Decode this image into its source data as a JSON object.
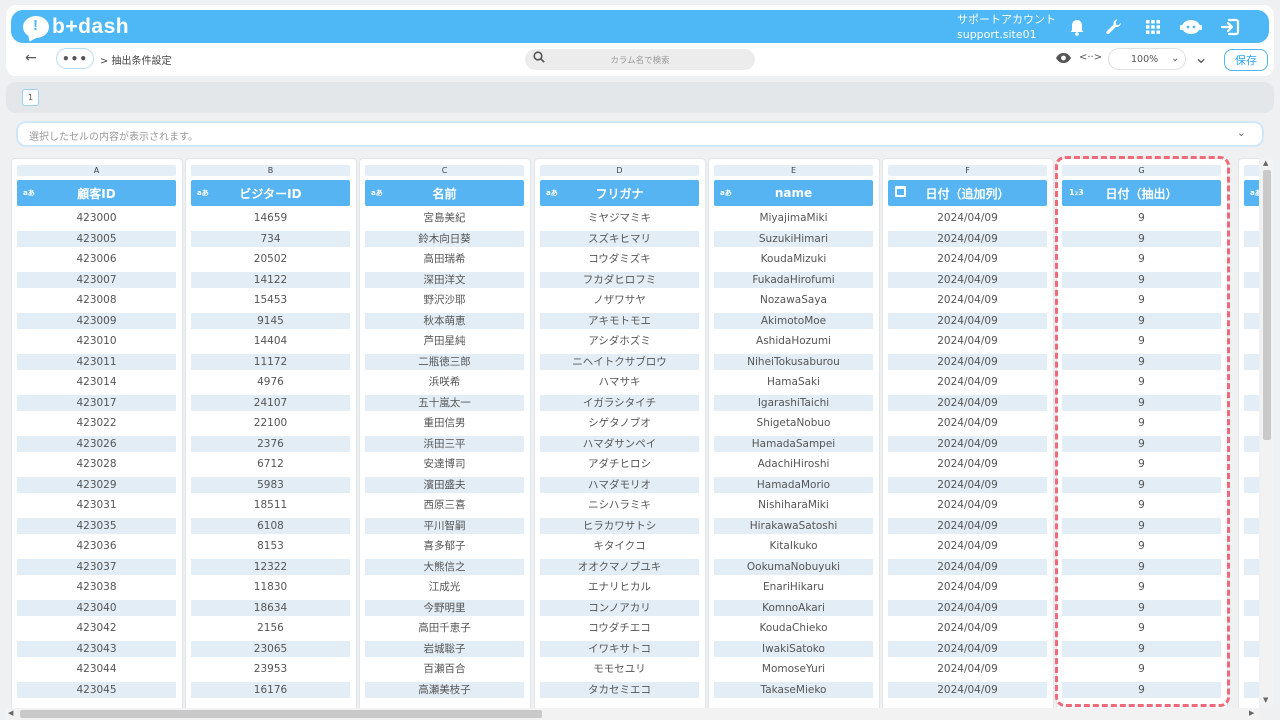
{
  "app": {
    "logo_text": "b+dash",
    "logo_mark": "!"
  },
  "header": {
    "account_label": "サポートアカウント",
    "site_label": "support.site01",
    "icons": [
      "bell-icon",
      "wrench-icon",
      "grid-icon",
      "chat-bot-icon",
      "logout-icon"
    ]
  },
  "toolbar": {
    "back_icon": "←",
    "more_label": "•••",
    "breadcrumb": "> 抽出条件設定",
    "search_placeholder": "カラム名で検索",
    "zoom": "100%",
    "save_label": "保存"
  },
  "pages": {
    "current": "1"
  },
  "cell_preview": {
    "placeholder": "選択したセルの内容が表示されます。"
  },
  "columns": [
    {
      "letter": "A",
      "title": "顧客ID",
      "type_tag": "aあ",
      "type": "text"
    },
    {
      "letter": "B",
      "title": "ビジターID",
      "type_tag": "aあ",
      "type": "text"
    },
    {
      "letter": "C",
      "title": "名前",
      "type_tag": "aあ",
      "type": "text"
    },
    {
      "letter": "D",
      "title": "フリガナ",
      "type_tag": "aあ",
      "type": "text"
    },
    {
      "letter": "E",
      "title": "name",
      "type_tag": "aあ",
      "type": "text"
    },
    {
      "letter": "F",
      "title": "日付（追加列）",
      "type_tag": "",
      "type": "date"
    },
    {
      "letter": "G",
      "title": "日付（抽出）",
      "type_tag": "1₂3",
      "type": "number"
    }
  ],
  "rows": [
    [
      "423000",
      "14659",
      "宮島美紀",
      "ミヤジマミキ",
      "MiyajimaMiki",
      "2024/04/09",
      "9"
    ],
    [
      "423005",
      "734",
      "鈴木向日葵",
      "スズキヒマリ",
      "SuzukiHimari",
      "2024/04/09",
      "9"
    ],
    [
      "423006",
      "20502",
      "高田瑞希",
      "コウダミズキ",
      "KoudaMizuki",
      "2024/04/09",
      "9"
    ],
    [
      "423007",
      "14122",
      "深田洋文",
      "フカダヒロフミ",
      "FukadaHirofumi",
      "2024/04/09",
      "9"
    ],
    [
      "423008",
      "15453",
      "野沢沙耶",
      "ノザワサヤ",
      "NozawaSaya",
      "2024/04/09",
      "9"
    ],
    [
      "423009",
      "9145",
      "秋本萌恵",
      "アキモトモエ",
      "AkimotoMoe",
      "2024/04/09",
      "9"
    ],
    [
      "423010",
      "14404",
      "芦田星純",
      "アシダホズミ",
      "AshidaHozumi",
      "2024/04/09",
      "9"
    ],
    [
      "423011",
      "11172",
      "二瓶徳三郎",
      "ニヘイトクサブロウ",
      "NiheiTokusaburou",
      "2024/04/09",
      "9"
    ],
    [
      "423014",
      "4976",
      "浜咲希",
      "ハマサキ",
      "HamaSaki",
      "2024/04/09",
      "9"
    ],
    [
      "423017",
      "24107",
      "五十嵐太一",
      "イガラシタイチ",
      "IgarashiTaichi",
      "2024/04/09",
      "9"
    ],
    [
      "423022",
      "22100",
      "重田信男",
      "シゲタノブオ",
      "ShigetaNobuo",
      "2024/04/09",
      "9"
    ],
    [
      "423026",
      "2376",
      "浜田三平",
      "ハマダサンペイ",
      "HamadaSampei",
      "2024/04/09",
      "9"
    ],
    [
      "423028",
      "6712",
      "安達博司",
      "アダチヒロシ",
      "AdachiHiroshi",
      "2024/04/09",
      "9"
    ],
    [
      "423029",
      "5983",
      "濱田盛夫",
      "ハマダモリオ",
      "HamadaMorio",
      "2024/04/09",
      "9"
    ],
    [
      "423031",
      "18511",
      "西原三喜",
      "ニシハラミキ",
      "NishiharaMiki",
      "2024/04/09",
      "9"
    ],
    [
      "423035",
      "6108",
      "平川智嗣",
      "ヒラカワサトシ",
      "HirakawaSatoshi",
      "2024/04/09",
      "9"
    ],
    [
      "423036",
      "8153",
      "喜多郁子",
      "キタイクコ",
      "KitaIkuko",
      "2024/04/09",
      "9"
    ],
    [
      "423037",
      "12322",
      "大熊信之",
      "オオクマノブユキ",
      "OokumaNobuyuki",
      "2024/04/09",
      "9"
    ],
    [
      "423038",
      "11830",
      "江成光",
      "エナリヒカル",
      "EnariHikaru",
      "2024/04/09",
      "9"
    ],
    [
      "423040",
      "18634",
      "今野明里",
      "コンノアカリ",
      "KomnoAkari",
      "2024/04/09",
      "9"
    ],
    [
      "423042",
      "2156",
      "高田千恵子",
      "コウダチエコ",
      "KoudaChieko",
      "2024/04/09",
      "9"
    ],
    [
      "423043",
      "23065",
      "岩城聡子",
      "イワキサトコ",
      "IwakiSatoko",
      "2024/04/09",
      "9"
    ],
    [
      "423044",
      "23953",
      "百瀬百合",
      "モモセユリ",
      "MomoseYuri",
      "2024/04/09",
      "9"
    ],
    [
      "423045",
      "16176",
      "高瀬美枝子",
      "タカセミエコ",
      "TakaseMieko",
      "2024/04/09",
      "9"
    ]
  ],
  "stub_column": {
    "type_tag": "aあ"
  },
  "colors": {
    "accent": "#4db8f5",
    "header_cell": "#57b4f2",
    "row_alt": "#e2edf6",
    "selection": "#ef6a78"
  }
}
